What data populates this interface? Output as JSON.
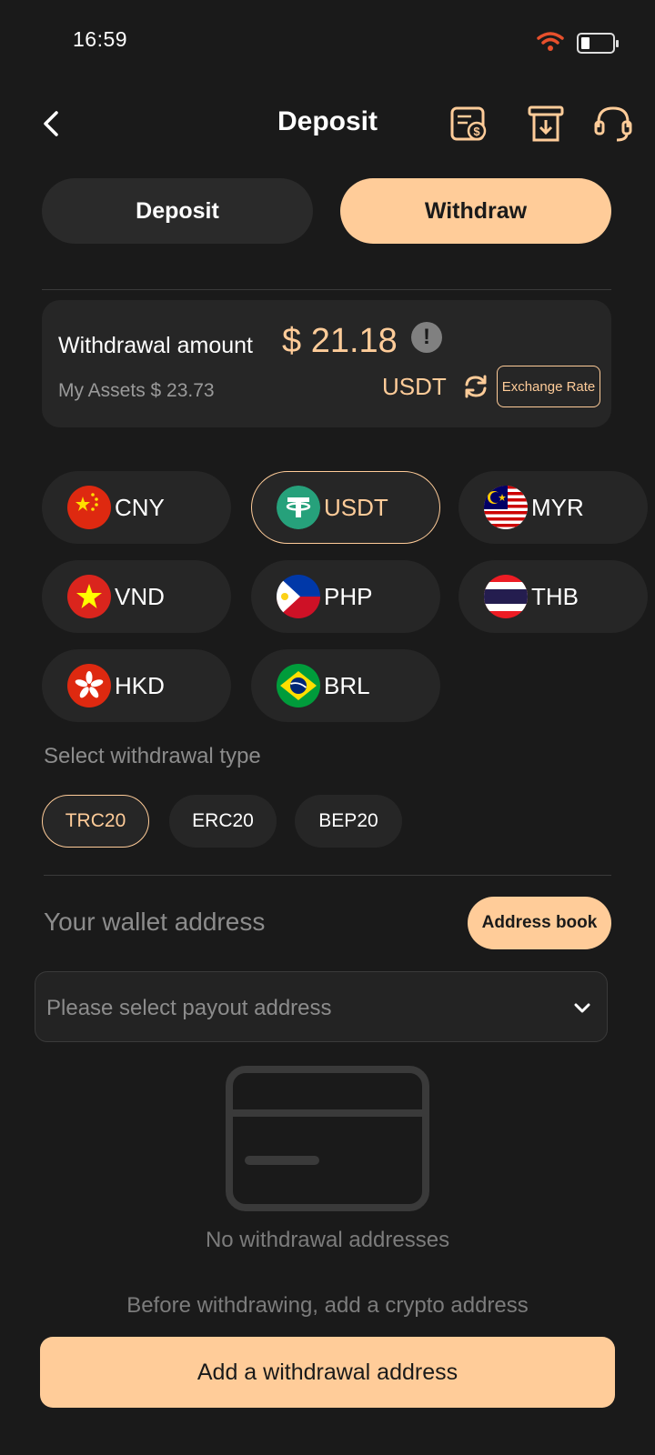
{
  "status_bar": {
    "time": "16:59"
  },
  "header": {
    "title": "Deposit"
  },
  "tabs": {
    "deposit": "Deposit",
    "withdraw": "Withdraw"
  },
  "amount_card": {
    "label": "Withdrawal amount",
    "amount": "$ 21.18",
    "info_icon": "!",
    "assets_label": "My Assets  $ 23.73",
    "currency": "USDT",
    "exchange_rate": "Exchange Rate"
  },
  "currencies": [
    {
      "code": "CNY",
      "flag": "china-flag"
    },
    {
      "code": "USDT",
      "flag": "tether-logo",
      "selected": true
    },
    {
      "code": "MYR",
      "flag": "malaysia-flag"
    },
    {
      "code": "VND",
      "flag": "vietnam-flag"
    },
    {
      "code": "PHP",
      "flag": "philippines-flag"
    },
    {
      "code": "THB",
      "flag": "thailand-flag"
    },
    {
      "code": "HKD",
      "flag": "hong-kong-flag"
    },
    {
      "code": "BRL",
      "flag": "brazil-flag"
    }
  ],
  "withdrawal_type": {
    "label": "Select withdrawal type",
    "options": [
      "TRC20",
      "ERC20",
      "BEP20"
    ],
    "selected": "TRC20"
  },
  "wallet": {
    "label": "Your wallet address",
    "address_book": "Address book",
    "select_placeholder": "Please select payout address",
    "empty_text": "No withdrawal addresses",
    "hint_text": "Before withdrawing, add a crypto address",
    "add_button": "Add a withdrawal address"
  },
  "colors": {
    "accent": "#ffcc99",
    "background": "#1a1a1a",
    "card": "#262626",
    "wifi": "#e8502c"
  }
}
